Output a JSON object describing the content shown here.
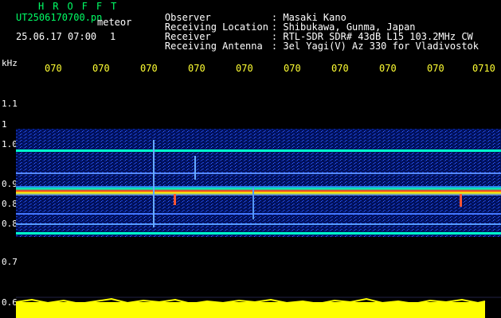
{
  "header": {
    "brand": "HROFFT",
    "filename": "UT2506170700.pn",
    "mode": "meteor",
    "datetime": "25.06.17 07:00",
    "count": "1"
  },
  "info": {
    "rows": [
      {
        "label": "Observer",
        "value": ": Masaki Kano"
      },
      {
        "label": "Receiving Location",
        "value": ": Shibukawa, Gunma, Japan"
      },
      {
        "label": "Receiver",
        "value": ": RTL-SDR SDR# 43dB L15 103.2MHz CW"
      },
      {
        "label": "Receiving Antenna",
        "value": ": 3el Yagi(V) Az 330 for Vladivostok"
      }
    ]
  },
  "axis": {
    "unit": "kHz",
    "time_ticks": [
      "070",
      "070",
      "070",
      "070",
      "070",
      "070",
      "070",
      "070",
      "070",
      "0710"
    ],
    "freq_ticks": [
      "1.1",
      "1",
      "1.0",
      "0.9",
      "0.8",
      "0.8",
      "0.7",
      "0.6"
    ]
  },
  "colors": {
    "background": "#000000",
    "header_green": "#00ff66",
    "tick_yellow": "#ffff33",
    "label_white": "#ffffff",
    "signal_line": "#00ffff",
    "strong_signal": "#ff2222"
  }
}
